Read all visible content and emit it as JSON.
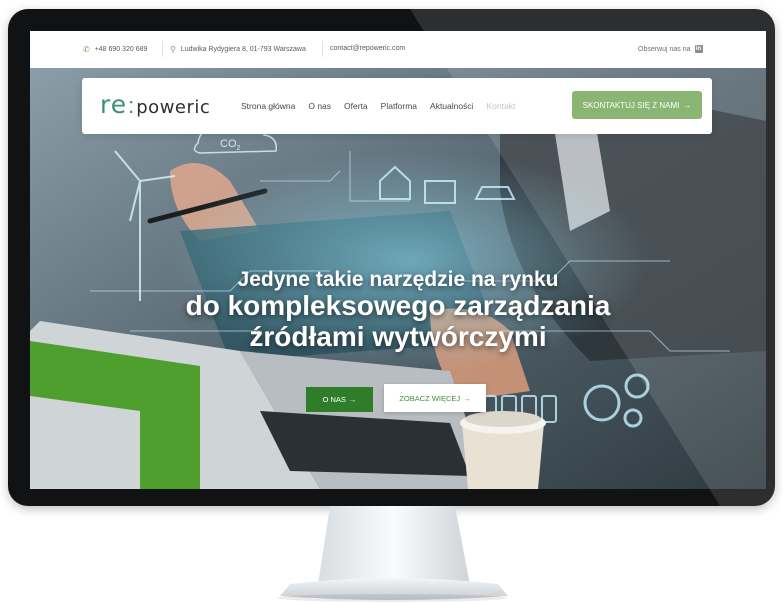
{
  "topbar": {
    "phone": "+48 690 320 689",
    "address": "Ludwika Rydygiera 8, 01-793 Warszawa",
    "email": "contact@repoweric.com",
    "follow": "Obserwuj nas na",
    "linkedin_glyph": "in"
  },
  "nav": {
    "logo_mark": "re",
    "logo_colon": ":",
    "logo_text": "poweric",
    "items": [
      {
        "label": "Strona główna"
      },
      {
        "label": "O nas"
      },
      {
        "label": "Oferta"
      },
      {
        "label": "Platforma"
      },
      {
        "label": "Aktualności"
      },
      {
        "label": "Kontakt"
      }
    ],
    "cta_label": "SKONTAKTUJ SIĘ Z NAMI",
    "arrow": "→"
  },
  "hero": {
    "line1": "Jedyne takie narzędzie na rynku",
    "line2": "do kompleksowego zarządzania",
    "line3": "źródłami wytwórczymi",
    "btn_about": "O NAS",
    "btn_more": "ZOBACZ WIĘCEJ",
    "co2_label": "CO",
    "co2_sub": "2"
  },
  "icons": {
    "phone": "phone-icon",
    "location": "location-pin-icon",
    "linkedin": "linkedin-icon",
    "arrow": "arrow-right-icon"
  },
  "colors": {
    "brand_green": "#3f8f72",
    "cta_green": "#7bab5f",
    "button_dark_green": "#2f7d2b",
    "monitor_bezel": "#101214"
  }
}
